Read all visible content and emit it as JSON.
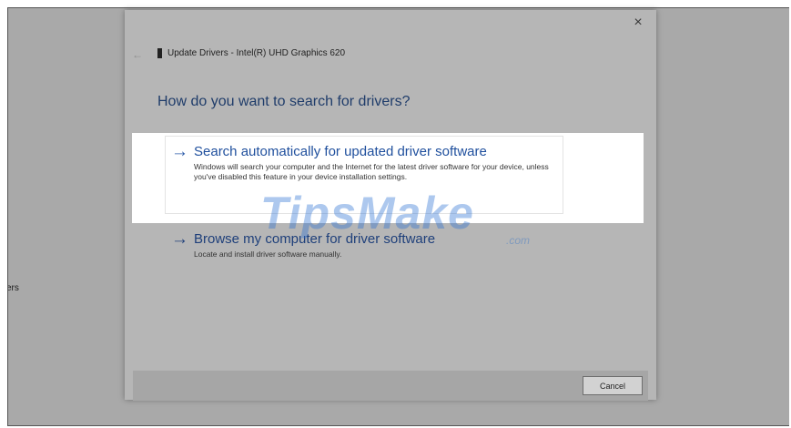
{
  "background": {
    "label": "ers"
  },
  "dialog": {
    "title": "Update Drivers - Intel(R) UHD Graphics 620",
    "heading": "How do you want to search for drivers?",
    "close_label": "×",
    "back_label": "←",
    "options": [
      {
        "arrow": "→",
        "title": "Search automatically for updated driver software",
        "description": "Windows will search your computer and the Internet for the latest driver software for your device, unless you've disabled this feature in your device installation settings."
      },
      {
        "arrow": "→",
        "title": "Browse my computer for driver software",
        "description": "Locate and install driver software manually."
      }
    ],
    "cancel_label": "Cancel"
  },
  "watermark": {
    "main": "TipsMake",
    "suffix": ".com"
  },
  "icons": {
    "back": "back-arrow-icon",
    "close": "close-icon",
    "device": "device-icon",
    "option": "arrow-right-icon"
  },
  "colors": {
    "accent": "#1f4f9d",
    "highlight": "#ffffff",
    "overlay": "#a9a9a9"
  }
}
